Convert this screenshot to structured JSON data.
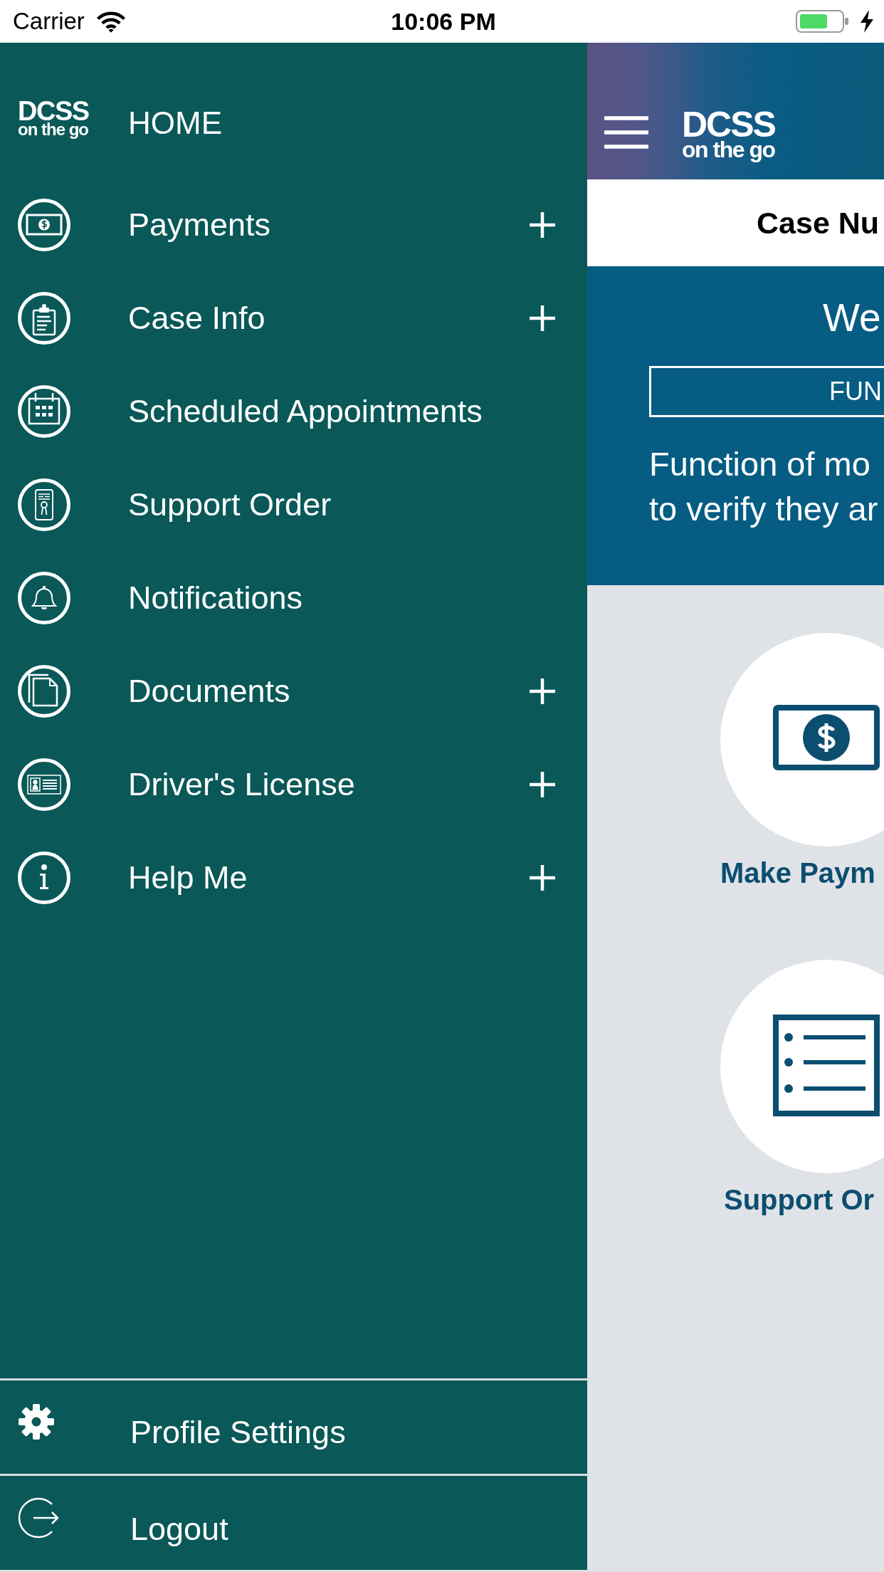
{
  "status_bar": {
    "carrier": "Carrier",
    "time": "10:06 PM"
  },
  "drawer": {
    "logo": {
      "top": "DCSS",
      "bottom": "on the go"
    },
    "home": "HOME",
    "items": [
      {
        "label": "Payments",
        "expandable": true
      },
      {
        "label": "Case Info",
        "expandable": true
      },
      {
        "label": "Scheduled Appointments",
        "expandable": false
      },
      {
        "label": "Support Order",
        "expandable": false
      },
      {
        "label": "Notifications",
        "expandable": false
      },
      {
        "label": "Documents",
        "expandable": true
      },
      {
        "label": "Driver's License",
        "expandable": true
      },
      {
        "label": "Help Me",
        "expandable": true
      }
    ],
    "footer_items": [
      {
        "label": "Profile Settings"
      },
      {
        "label": "Logout"
      }
    ]
  },
  "main": {
    "header": {
      "logo": {
        "top": "DCSS",
        "bottom": "on the go"
      }
    },
    "case_heading": "Case Nu",
    "welcome": {
      "title": "We",
      "banner": "FUN",
      "description": [
        "Function of mo",
        "to verify they ar"
      ]
    },
    "tiles": [
      {
        "label": "Make Paym"
      },
      {
        "label": "Support Or"
      }
    ]
  }
}
